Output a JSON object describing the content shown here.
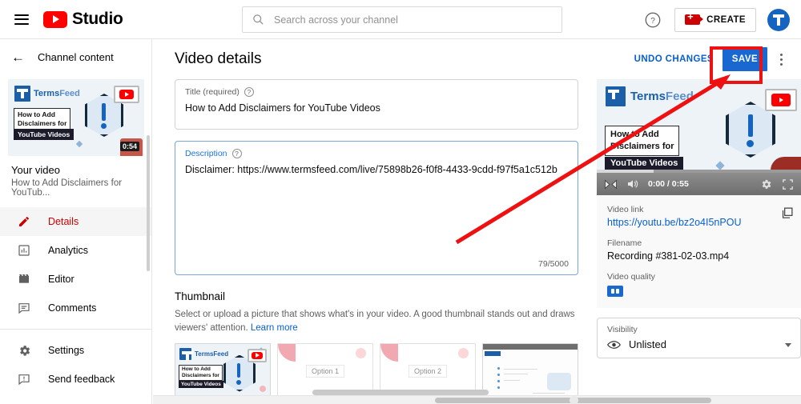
{
  "topbar": {
    "menu_icon": "hamburger-menu-icon",
    "brand": "Studio",
    "search_placeholder": "Search across your channel",
    "search_value": "",
    "help_icon": "help-question-icon",
    "create_label": "CREATE",
    "avatar_label": "T"
  },
  "sidebar": {
    "back_label": "Channel content",
    "thumbnail": {
      "logo_text_a": "Terms",
      "logo_text_b": "Feed",
      "overlay_line1": "How to Add",
      "overlay_line2": "Disclaimers for",
      "overlay_line3": "YouTube Videos",
      "duration": "0:54"
    },
    "your_video_label": "Your video",
    "your_video_title": "How to Add Disclaimers for YouTub...",
    "items": [
      {
        "label": "Details",
        "icon": "pencil-icon",
        "active": true
      },
      {
        "label": "Analytics",
        "icon": "bar-chart-icon",
        "active": false
      },
      {
        "label": "Editor",
        "icon": "clapperboard-icon",
        "active": false
      },
      {
        "label": "Comments",
        "icon": "comment-icon",
        "active": false
      }
    ],
    "footer_items": [
      {
        "label": "Settings",
        "icon": "gear-icon"
      },
      {
        "label": "Send feedback",
        "icon": "feedback-icon"
      }
    ]
  },
  "main": {
    "page_title": "Video details",
    "undo_label": "UNDO CHANGES",
    "save_label": "SAVE",
    "more_icon": "kebab-menu-icon",
    "title_field": {
      "label": "Title (required)",
      "value": "How to Add Disclaimers for YouTube Videos"
    },
    "description_field": {
      "label": "Description",
      "value": "Disclaimer: https://www.termsfeed.com/live/75898b26-f0f8-4433-9cdd-f97f5a1c512b",
      "counter": "79/5000"
    },
    "thumbnail_section": {
      "title": "Thumbnail",
      "description": "Select or upload a picture that shows what's in your video. A good thumbnail stands out and draws viewers' attention.",
      "learn_more": "Learn more",
      "options": [
        {
          "name": "current-thumbnail",
          "label": ""
        },
        {
          "name": "thumbnail-option-1",
          "label": "Option 1"
        },
        {
          "name": "thumbnail-option-2",
          "label": "Option 2"
        },
        {
          "name": "thumbnail-option-3",
          "label": ""
        }
      ]
    }
  },
  "right_panel": {
    "player": {
      "current_time": "0:00",
      "total_time": "0:55",
      "time_display": "0:00 / 0:55",
      "overlay_line1": "How to Add",
      "overlay_line2": "Disclaimers for",
      "overlay_line3": "YouTube Videos",
      "logo_text_a": "Terms",
      "logo_text_b": "Feed"
    },
    "video_link_label": "Video link",
    "video_link_value": "https://youtu.be/bz2o4I5nPOU",
    "copy_icon": "copy-icon",
    "filename_label": "Filename",
    "filename_value": "Recording #381-02-03.mp4",
    "quality_label": "Video quality",
    "quality_badge": "sd-quality-badge",
    "visibility_label": "Visibility",
    "visibility_value": "Unlisted",
    "visibility_icon": "eye-icon"
  },
  "annotation": {
    "highlight_target": "save-button",
    "box_color": "#ee1111",
    "arrow_color": "#ee1111"
  },
  "colors": {
    "accent_blue": "#1968d2",
    "link_blue": "#065fd4",
    "youtube_red": "#ff0000",
    "active_red": "#cc0000",
    "annotation_red": "#ee1111"
  }
}
